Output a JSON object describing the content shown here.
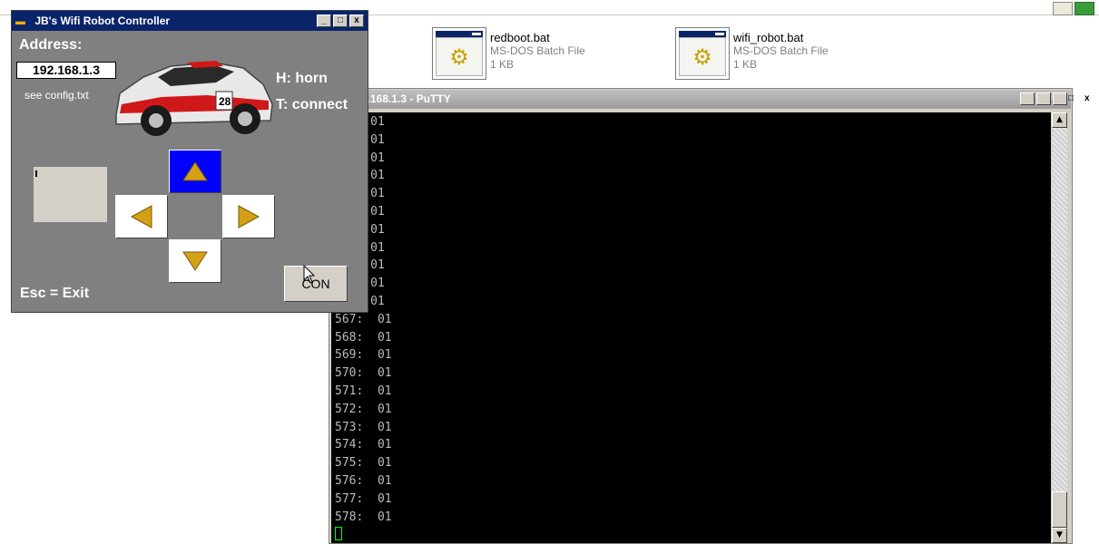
{
  "explorer": {
    "files": [
      {
        "name": "redboot.bat",
        "type": "MS-DOS Batch File",
        "size": "1 KB",
        "icon": "batch-file-icon"
      },
      {
        "name": "wifi_robot.bat",
        "type": "MS-DOS Batch File",
        "size": "1 KB",
        "icon": "batch-file-icon"
      }
    ]
  },
  "putty": {
    "title": "2.168.1.3 - PuTTY",
    "controls": {
      "minimize": "_",
      "maximize": "□",
      "close": "x"
    },
    "lines": [
      "     01",
      "     01",
      "     01",
      "     01",
      "     01",
      "     01",
      "     01",
      "     01",
      "     01",
      "     01",
      "     01",
      "567:  01",
      "568:  01",
      "569:  01",
      "570:  01",
      "571:  01",
      "572:  01",
      "573:  01",
      "574:  01",
      "575:  01",
      "576:  01",
      "577:  01",
      "578:  01"
    ],
    "scroll_up": "▲",
    "scroll_down": "▼"
  },
  "robot": {
    "title": "JB's Wifi Robot Controller",
    "controls": {
      "minimize": "_",
      "maximize": "□",
      "close": "x"
    },
    "address_label": "Address:",
    "address_value": "192.168.1.3",
    "config_hint": "see config.txt",
    "horn_hint": "H: horn",
    "connect_hint": "T: connect",
    "exit_hint": "Esc = Exit",
    "con_button": "CON",
    "active_direction": "up",
    "colors": {
      "active": "#0000ff",
      "arrow": "#d4a017",
      "panel": "#808080"
    }
  }
}
